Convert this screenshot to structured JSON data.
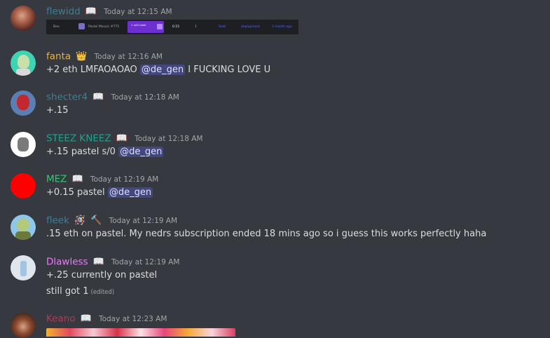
{
  "messages": [
    {
      "username": "flewidd",
      "color": "#3d7f94",
      "badge": "📖",
      "badge_icon": "book-icon",
      "timestamp": "Today at 12:15 AM",
      "embed": {
        "col1": "Bee",
        "col2": "Pastel Mosaic #775",
        "col3": "1 unit label",
        "col4": "0.15",
        "col5": "1",
        "col6": "Sold",
        "col7": "deployment",
        "col8": "1 month ago"
      }
    },
    {
      "username": "fanta",
      "color": "#f0b232",
      "badge": "👑",
      "badge_icon": "crown-icon",
      "timestamp": "Today at 12:16 AM",
      "text_before": "+2 eth LMFAOAOAO ",
      "mention": "@de_gen",
      "text_after": " I FUCKING LOVE U"
    },
    {
      "username": "shecter4",
      "color": "#3d7f94",
      "badge": "📖",
      "badge_icon": "book-icon",
      "timestamp": "Today at 12:18 AM",
      "text": "+.15"
    },
    {
      "username": "STEEZ KNEEZ",
      "color": "#1fa38d",
      "badge": "📖",
      "badge_icon": "book-icon",
      "timestamp": "Today at 12:18 AM",
      "text_before": "+.15 pastel s/0 ",
      "mention": "@de_gen"
    },
    {
      "username": "MEZ",
      "color": "#2ecc71",
      "badge": "📖",
      "badge_icon": "book-icon",
      "timestamp": "Today at 12:19 AM",
      "text_before": "+0.15 pastel ",
      "mention": "@de_gen"
    },
    {
      "username": "fleek",
      "color": "#3d7f94",
      "badge": "🪅",
      "badge_icon": "feather-icon",
      "badge2": "🔨",
      "badge2_icon": "hammer-icon",
      "timestamp": "Today at 12:19 AM",
      "text": ".15 eth on pastel. My nedrs subscription ended 18 mins ago so i guess this works perfectly haha"
    },
    {
      "username": "Dlawless",
      "color": "#e77ef7",
      "badge": "📖",
      "badge_icon": "book-icon",
      "timestamp": "Today at 12:19 AM",
      "text": "+.25 currently on pastel",
      "text2": "still got 1",
      "edited": "(edited)"
    },
    {
      "username": "Keano",
      "color": "#b23a5a",
      "badge": "📖",
      "badge_icon": "book-icon",
      "timestamp": "Today at 12:23 AM"
    }
  ]
}
